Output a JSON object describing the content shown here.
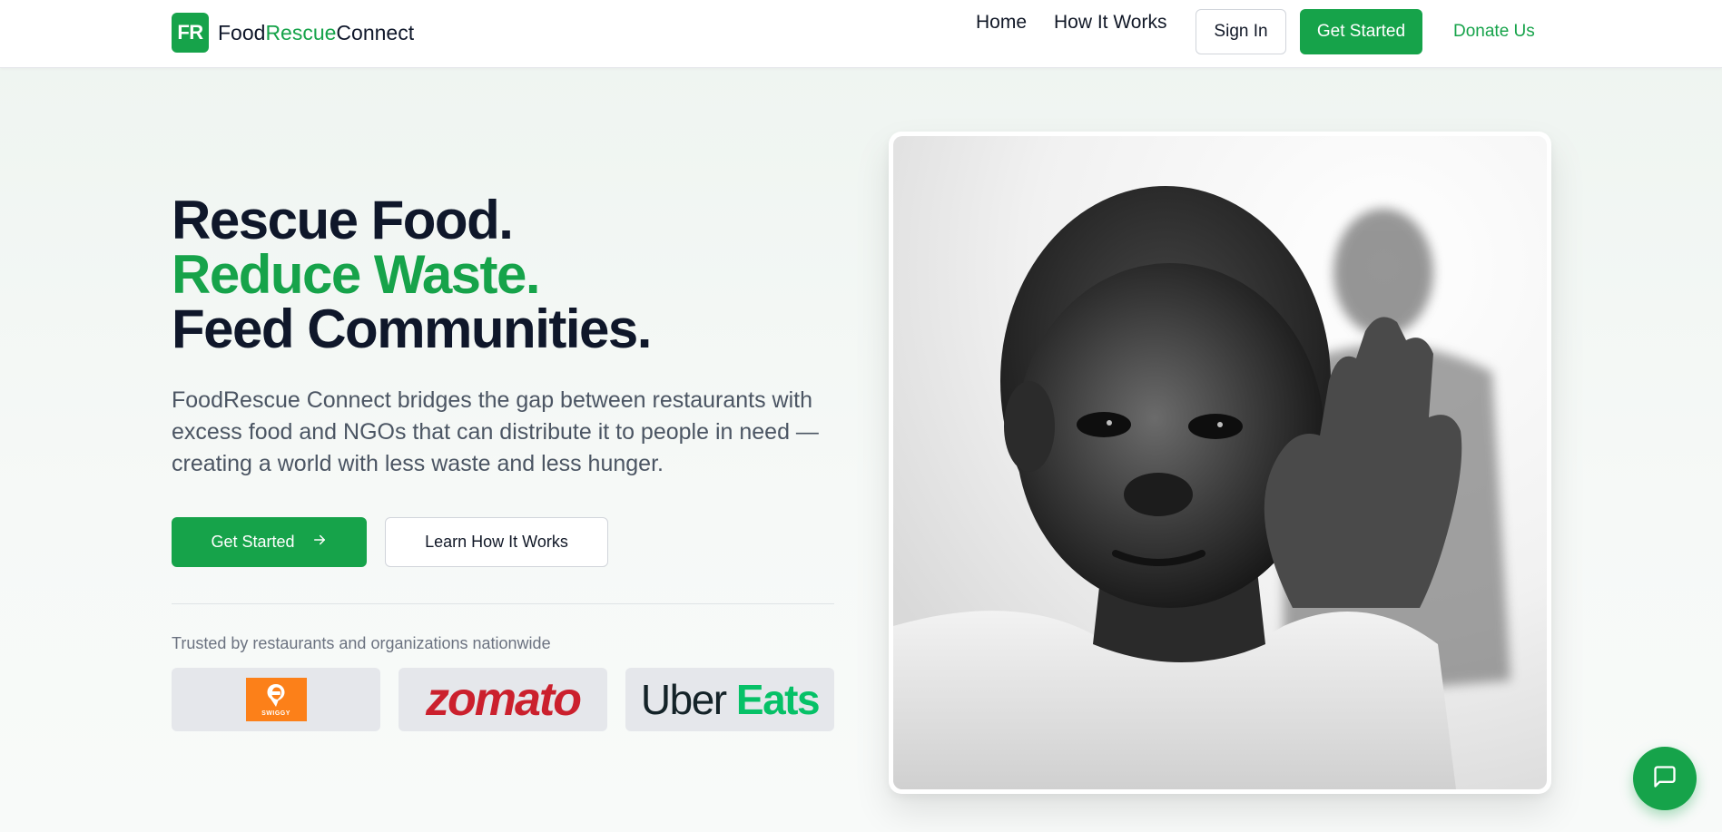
{
  "brand": {
    "badge": "FR",
    "name_part1": "Food",
    "name_part2": "Rescue",
    "name_part3": "Connect",
    "accent_color": "#16a34a"
  },
  "nav": {
    "home": "Home",
    "how_it_works": "How It Works",
    "sign_in": "Sign In",
    "get_started": "Get Started",
    "donate": "Donate Us"
  },
  "hero": {
    "line1": "Rescue Food.",
    "line2": "Reduce Waste.",
    "line3": "Feed Communities.",
    "description": "FoodRescue Connect bridges the gap between restaurants with excess food and NGOs that can distribute it to people in need — creating a world with less waste and less hunger.",
    "primary_button": "Get Started",
    "primary_icon": "arrow-right-icon",
    "secondary_button": "Learn How It Works"
  },
  "trusted": {
    "caption": "Trusted by restaurants and organizations nationwide",
    "partners": [
      {
        "name": "SWIGGY",
        "color": "#fc8019"
      },
      {
        "name": "zomato",
        "color": "#cb202d"
      },
      {
        "name_part1": "Uber",
        "name_part2": "Eats",
        "color": "#06c167"
      }
    ]
  },
  "chat": {
    "icon": "message-square-icon"
  }
}
